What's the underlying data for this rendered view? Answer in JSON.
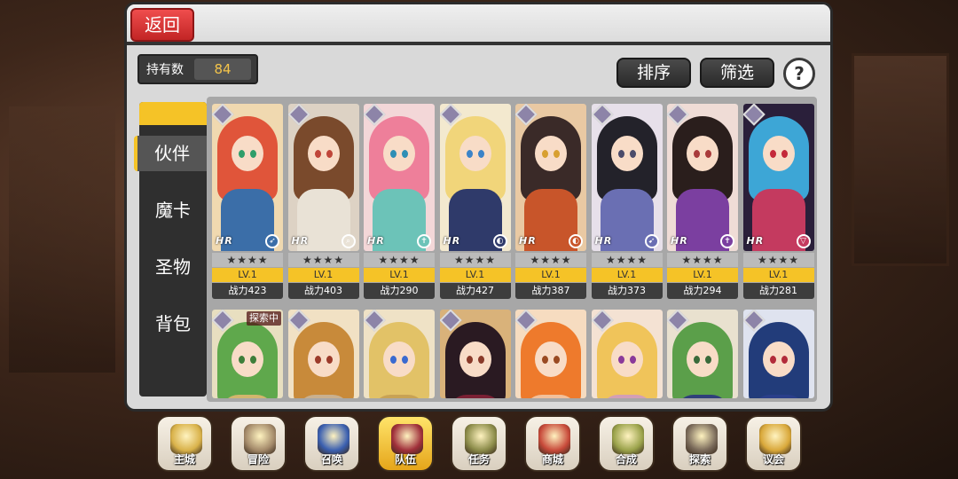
{
  "header": {
    "back_label": "返回"
  },
  "holding": {
    "label": "持有数",
    "value": "84"
  },
  "toolbar": {
    "sort_label": "排序",
    "filter_label": "筛选",
    "help_label": "?"
  },
  "tabs": [
    {
      "label": "伙伴",
      "active": true
    },
    {
      "label": "魔卡",
      "active": false
    },
    {
      "label": "圣物",
      "active": false
    },
    {
      "label": "背包",
      "active": false
    }
  ],
  "cards_row1": [
    {
      "stars": "★★★★",
      "level": "LV.1",
      "power": "战力423",
      "rarity": "HR",
      "class_icon": "bow-icon",
      "palette": {
        "hair": "#e0553a",
        "body": "#3b6ea8",
        "eye": "#2f9e6a",
        "bg": "#f0d9b0"
      }
    },
    {
      "stars": "★★★★",
      "level": "LV.1",
      "power": "战力403",
      "rarity": "HR",
      "class_icon": "magnifier-icon",
      "palette": {
        "hair": "#7a4a2c",
        "body": "#e9e2d6",
        "eye": "#c0463a",
        "bg": "#ddd2c4"
      }
    },
    {
      "stars": "★★★★",
      "level": "LV.1",
      "power": "战力290",
      "rarity": "HR",
      "class_icon": "cross-icon",
      "palette": {
        "hair": "#ee7f9a",
        "body": "#6cc3b8",
        "eye": "#2f8fb5",
        "bg": "#f3d7d8"
      }
    },
    {
      "stars": "★★★★",
      "level": "LV.1",
      "power": "战力427",
      "rarity": "HR",
      "class_icon": "orb-icon",
      "palette": {
        "hair": "#f1d57a",
        "body": "#2f3a6a",
        "eye": "#3b83c8",
        "bg": "#f3e9cf"
      }
    },
    {
      "stars": "★★★★",
      "level": "LV.1",
      "power": "战力387",
      "rarity": "HR",
      "class_icon": "orb-icon",
      "palette": {
        "hair": "#3a2a28",
        "body": "#c8552a",
        "eye": "#d8a030",
        "bg": "#e9c9a3"
      }
    },
    {
      "stars": "★★★★",
      "level": "LV.1",
      "power": "战力373",
      "rarity": "HR",
      "class_icon": "feather-icon",
      "palette": {
        "hair": "#23222a",
        "body": "#6a6fb3",
        "eye": "#4b4b6a",
        "bg": "#e7e0ea"
      }
    },
    {
      "stars": "★★★★",
      "level": "LV.1",
      "power": "战力294",
      "rarity": "HR",
      "class_icon": "cross-icon",
      "palette": {
        "hair": "#2a1e1c",
        "body": "#7b3fa0",
        "eye": "#a93b3b",
        "bg": "#efdcd6"
      }
    },
    {
      "stars": "★★★★",
      "level": "LV.1",
      "power": "战力281",
      "rarity": "HR",
      "class_icon": "shield-icon",
      "palette": {
        "hair": "#3da6d6",
        "body": "#c43a5f",
        "eye": "#c4293a",
        "bg": "#2a1f3a"
      }
    }
  ],
  "cards_row2": [
    {
      "tag": "探索中",
      "palette": {
        "hair": "#5fa84c",
        "body": "#d2b66d",
        "eye": "#3e7e3a",
        "bg": "#e8dfc0"
      }
    },
    {
      "tag": "",
      "palette": {
        "hair": "#c88a3a",
        "body": "#c9b08f",
        "eye": "#9c3a2a",
        "bg": "#f1e1c4"
      }
    },
    {
      "tag": "",
      "palette": {
        "hair": "#e2c267",
        "body": "#c8a255",
        "eye": "#3a6ad0",
        "bg": "#efe2c6"
      }
    },
    {
      "tag": "",
      "palette": {
        "hair": "#2a1a22",
        "body": "#7a2034",
        "eye": "#8a3a2a",
        "bg": "#d9b27a"
      }
    },
    {
      "tag": "",
      "palette": {
        "hair": "#ee7a2c",
        "body": "#f2c09a",
        "eye": "#9a4a22",
        "bg": "#f6dcc0"
      }
    },
    {
      "tag": "",
      "palette": {
        "hair": "#f0c45a",
        "body": "#d39fb5",
        "eye": "#8a3a9a",
        "bg": "#f4e2d3"
      }
    },
    {
      "tag": "",
      "palette": {
        "hair": "#5b9f4a",
        "body": "#2f3f7a",
        "eye": "#3a6a3a",
        "bg": "#e9e1cf"
      }
    },
    {
      "tag": "",
      "palette": {
        "hair": "#223c7a",
        "body": "#2a3f8a",
        "eye": "#b22b3a",
        "bg": "#dfe3ef"
      }
    }
  ],
  "bottom_nav": [
    {
      "label": "主城",
      "icon": "castle-icon",
      "active": false,
      "color": "#d9b24a"
    },
    {
      "label": "冒险",
      "icon": "swords-icon",
      "active": false,
      "color": "#a48a6a"
    },
    {
      "label": "召唤",
      "icon": "card-summon-icon",
      "active": false,
      "color": "#3a5fb0"
    },
    {
      "label": "队伍",
      "icon": "team-wings-icon",
      "active": true,
      "color": "#a0303a"
    },
    {
      "label": "任务",
      "icon": "book-icon",
      "active": false,
      "color": "#8c8c4a"
    },
    {
      "label": "商城",
      "icon": "mushroom-shop-icon",
      "active": false,
      "color": "#c84a3a"
    },
    {
      "label": "合成",
      "icon": "potion-icon",
      "active": false,
      "color": "#9aa24a"
    },
    {
      "label": "探索",
      "icon": "crossbow-icon",
      "active": false,
      "color": "#7a6a5a"
    },
    {
      "label": "议会",
      "icon": "council-icon",
      "active": false,
      "color": "#d9a83a"
    }
  ]
}
